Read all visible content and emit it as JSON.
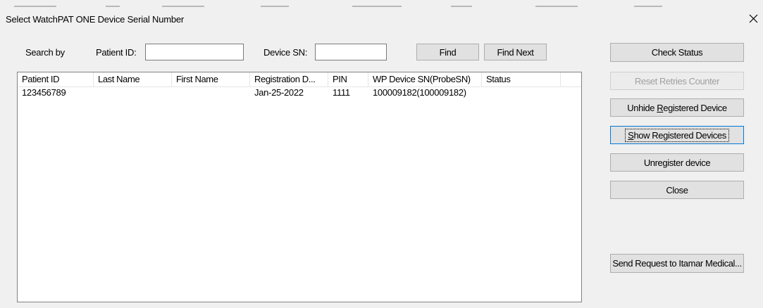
{
  "window": {
    "title": "Select WatchPAT ONE Device Serial Number"
  },
  "search": {
    "label": "Search by",
    "patient_id_label": "Patient ID:",
    "patient_id_value": "",
    "device_sn_label": "Device SN:",
    "device_sn_value": "",
    "find_label": "Find",
    "find_next_label": "Find Next"
  },
  "table": {
    "columns": [
      "Patient ID",
      "Last Name",
      "First Name",
      "Registration D...",
      "PIN",
      "WP Device SN(ProbeSN)",
      "Status"
    ],
    "rows": [
      {
        "patient_id": "123456789",
        "last_name": "",
        "first_name": "",
        "registration_date": "Jan-25-2022",
        "pin": "1111",
        "device_sn": "100009182(100009182)",
        "status": ""
      }
    ]
  },
  "actions": {
    "check_status": "Check Status",
    "reset_retries": "Reset Retries Counter",
    "unhide_prefix": "Unhide ",
    "unhide_accel": "R",
    "unhide_suffix": "egistered Device",
    "show_accel": "S",
    "show_suffix": "how Registered Devices",
    "unregister": "Unregister device",
    "close": "Close",
    "send_request": "Send Request to Itamar Medical..."
  }
}
